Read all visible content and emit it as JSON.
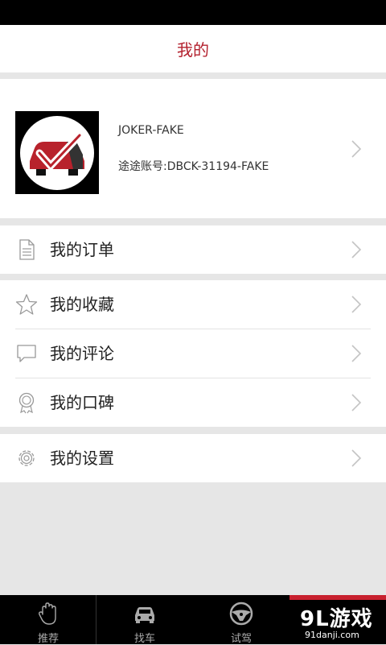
{
  "header": {
    "title": "我的"
  },
  "profile": {
    "name": "JOKER-FAKE",
    "account": "途途账号:DBCK-31194-FAKE"
  },
  "menu": {
    "orders": "我的订单",
    "favorites": "我的收藏",
    "comments": "我的评论",
    "reputation": "我的口碑",
    "settings": "我的设置"
  },
  "tabs": [
    {
      "label": "推荐",
      "icon": "hand-icon"
    },
    {
      "label": "找车",
      "icon": "car-icon"
    },
    {
      "label": "试驾",
      "icon": "steering-wheel-icon"
    },
    {
      "label": "",
      "icon": ""
    }
  ],
  "watermark": {
    "brand": "9L游戏",
    "site": "91danji.com"
  },
  "colors": {
    "accent": "#b3212e",
    "tab_bar": "#000000",
    "background": "#e6e6e6"
  }
}
